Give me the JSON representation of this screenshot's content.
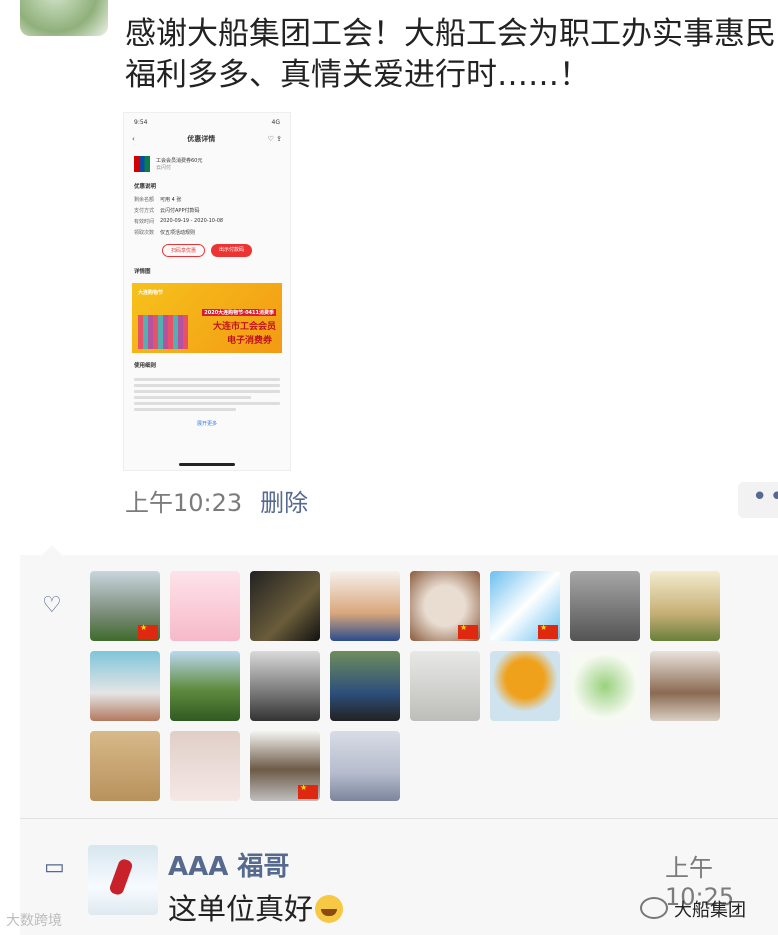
{
  "post": {
    "text": "感谢大船集团工会！大船工会为职工办实事惠民福利多多、真情关爱进行时……！",
    "time": "上午10:23",
    "delete_label": "删除",
    "more_label": "••"
  },
  "screenshot": {
    "status_time": "9:54",
    "status_signal": "4G",
    "nav_title": "优惠详情",
    "coupon_title": "工会会员消费券60元",
    "coupon_sub": "云闪付",
    "section_info": "优惠说明",
    "rows": [
      {
        "k": "剩余名额",
        "v": "可用 4 张"
      },
      {
        "k": "支付方式",
        "v": "云闪付APP付款码"
      },
      {
        "k": "有效时间",
        "v": "2020-09-19 - 2020-10-08"
      },
      {
        "k": "领取次数",
        "v": "仅五项活动规则"
      }
    ],
    "btn_scan": "扫码享优惠",
    "btn_pay": "出示付款码",
    "section_detail": "详情图",
    "poster_top": "大连购物节",
    "poster_event": "2020大连购物节·0411消费季",
    "poster_line1": "大连市工会会员",
    "poster_line2": "电子消费券",
    "section_rules": "使用细则",
    "more": "展开更多"
  },
  "likes": {
    "avatars": [
      {
        "name": "avatar-city",
        "flag": true,
        "bg": "linear-gradient(180deg,#c9d6de,#7c8d7a 60%,#3f6b2c)"
      },
      {
        "name": "avatar-cartoon-couple",
        "flag": false,
        "bg": "linear-gradient(180deg,#fde3ea,#f7b9c9)"
      },
      {
        "name": "avatar-gold-card",
        "flag": false,
        "bg": "linear-gradient(135deg,#222,#6b5d3b 60%,#111)"
      },
      {
        "name": "avatar-man-portrait",
        "flag": false,
        "bg": "linear-gradient(180deg,#f5f1ec,#d9a77d 60%,#2b4c8c)"
      },
      {
        "name": "avatar-calligraphy",
        "flag": true,
        "bg": "radial-gradient(circle,#e9ddd2 40%,#8a5a3c)"
      },
      {
        "name": "avatar-cartoon-boy",
        "flag": true,
        "bg": "linear-gradient(135deg,#6bbff0,#ffffff 50%,#6bbff0)"
      },
      {
        "name": "avatar-woman-photo",
        "flag": false,
        "bg": "linear-gradient(180deg,#a7a7a7,#545454)"
      },
      {
        "name": "avatar-landscape-text",
        "flag": false,
        "bg": "linear-gradient(180deg,#f3eccf,#c7b077 60%,#6a7f3b)"
      },
      {
        "name": "avatar-car-girl",
        "flag": false,
        "bg": "linear-gradient(180deg,#7fc5d9,#e5e5e5 60%,#b27a5e)"
      },
      {
        "name": "avatar-mountains",
        "flag": false,
        "bg": "linear-gradient(180deg,#bcd8ef,#5f8b3f 55%,#2f5a22)"
      },
      {
        "name": "avatar-motorcycle",
        "flag": false,
        "bg": "linear-gradient(180deg,#d9d9d9,#777 60%,#333)"
      },
      {
        "name": "avatar-man-computer",
        "flag": false,
        "bg": "linear-gradient(180deg,#6f8d5c,#2d4f7a 60%,#222)"
      },
      {
        "name": "avatar-sculpture",
        "flag": false,
        "bg": "linear-gradient(180deg,#e8e8e6,#bdbdb9)"
      },
      {
        "name": "avatar-autumn-tree",
        "flag": false,
        "bg": "radial-gradient(circle at 50% 40%,#f0a11c 35%,#cfe3ef 60%)"
      },
      {
        "name": "avatar-flower-art",
        "flag": false,
        "bg": "radial-gradient(circle,#9ad17d,#f7faf3 65%)"
      },
      {
        "name": "avatar-gate",
        "flag": false,
        "bg": "linear-gradient(180deg,#e9e3dc,#8b6a52 60%,#d9cfc2)"
      },
      {
        "name": "avatar-shadow-beach",
        "flag": false,
        "bg": "linear-gradient(180deg,#d8b98a,#b8925c)"
      },
      {
        "name": "avatar-baby",
        "flag": false,
        "bg": "linear-gradient(180deg,#e0cfc7,#f4e8e6)"
      },
      {
        "name": "avatar-house",
        "flag": true,
        "bg": "linear-gradient(180deg,#f3f4f1,#6d5a47 55%,#bfbfbf)"
      },
      {
        "name": "avatar-seaside-woman",
        "flag": false,
        "bg": "linear-gradient(180deg,#d8dce6,#b6bccd 60%,#7c859c)"
      }
    ]
  },
  "comment": {
    "author": "AAA 福哥",
    "time": "上午10:25",
    "text": "这单位真好"
  },
  "watermarks": {
    "left": "大数跨境",
    "right": "大船集团"
  }
}
